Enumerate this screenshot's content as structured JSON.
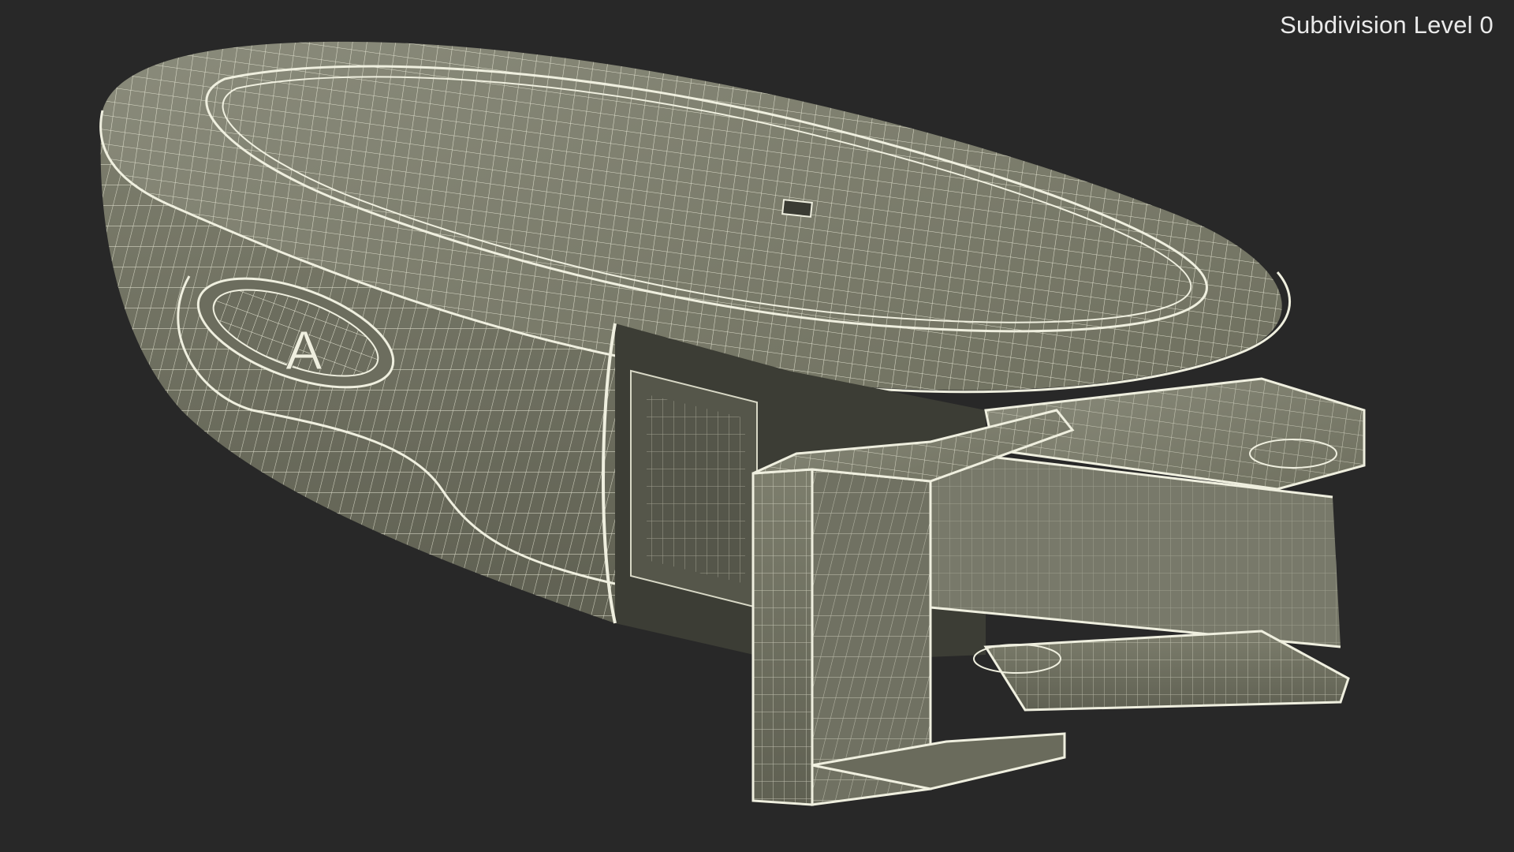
{
  "viewport": {
    "label": "Subdivision Level 0",
    "background_color": "#282828",
    "surface_color": "#7a7b6c",
    "wire_color": "#e9e9d8"
  },
  "model": {
    "emblem_glyph": "A"
  }
}
